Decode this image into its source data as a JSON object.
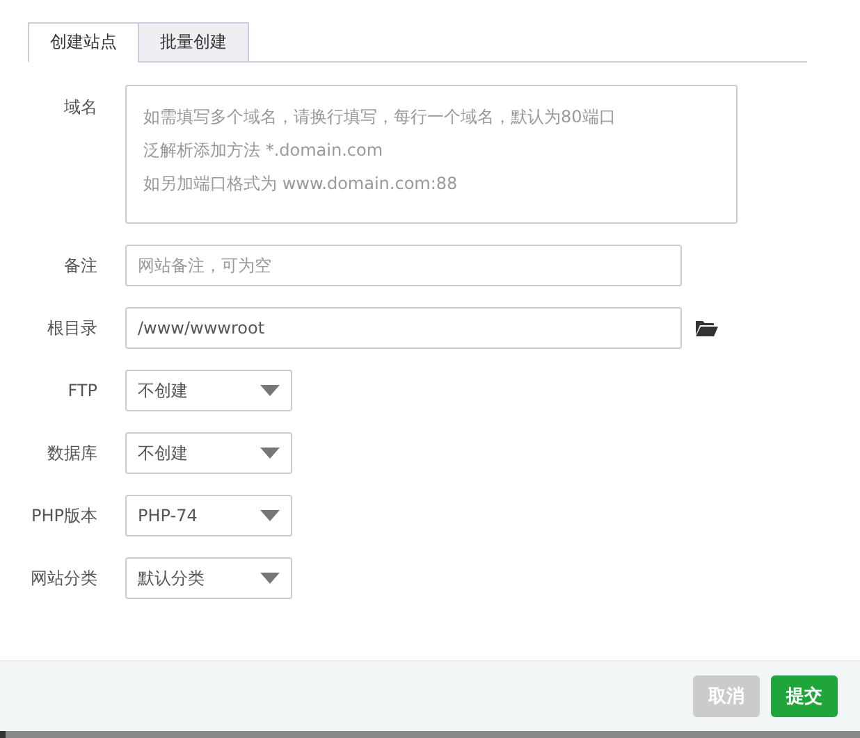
{
  "tabs": [
    {
      "label": "创建站点",
      "selected": true
    },
    {
      "label": "批量创建",
      "selected": false
    }
  ],
  "fields": [
    {
      "kind": "textarea",
      "label": "域名",
      "placeholder_lines": [
        "如需填写多个域名，请换行填写，每行一个域名，默认为80端口",
        "泛解析添加方法 *.domain.com",
        "如另加端口格式为 www.domain.com:88"
      ]
    },
    {
      "kind": "input",
      "label": "备注",
      "placeholder": "网站备注，可为空"
    },
    {
      "kind": "path",
      "label": "根目录",
      "value": "/www/wwwroot"
    },
    {
      "kind": "select",
      "label": "FTP",
      "value": "不创建"
    },
    {
      "kind": "select",
      "label": "数据库",
      "value": "不创建"
    },
    {
      "kind": "select",
      "label": "PHP版本",
      "value": "PHP-74"
    },
    {
      "kind": "select",
      "label": "网站分类",
      "value": "默认分类"
    }
  ],
  "buttons": [
    {
      "kind": "cancel",
      "label": "取消"
    },
    {
      "kind": "submit",
      "label": "提交"
    }
  ]
}
